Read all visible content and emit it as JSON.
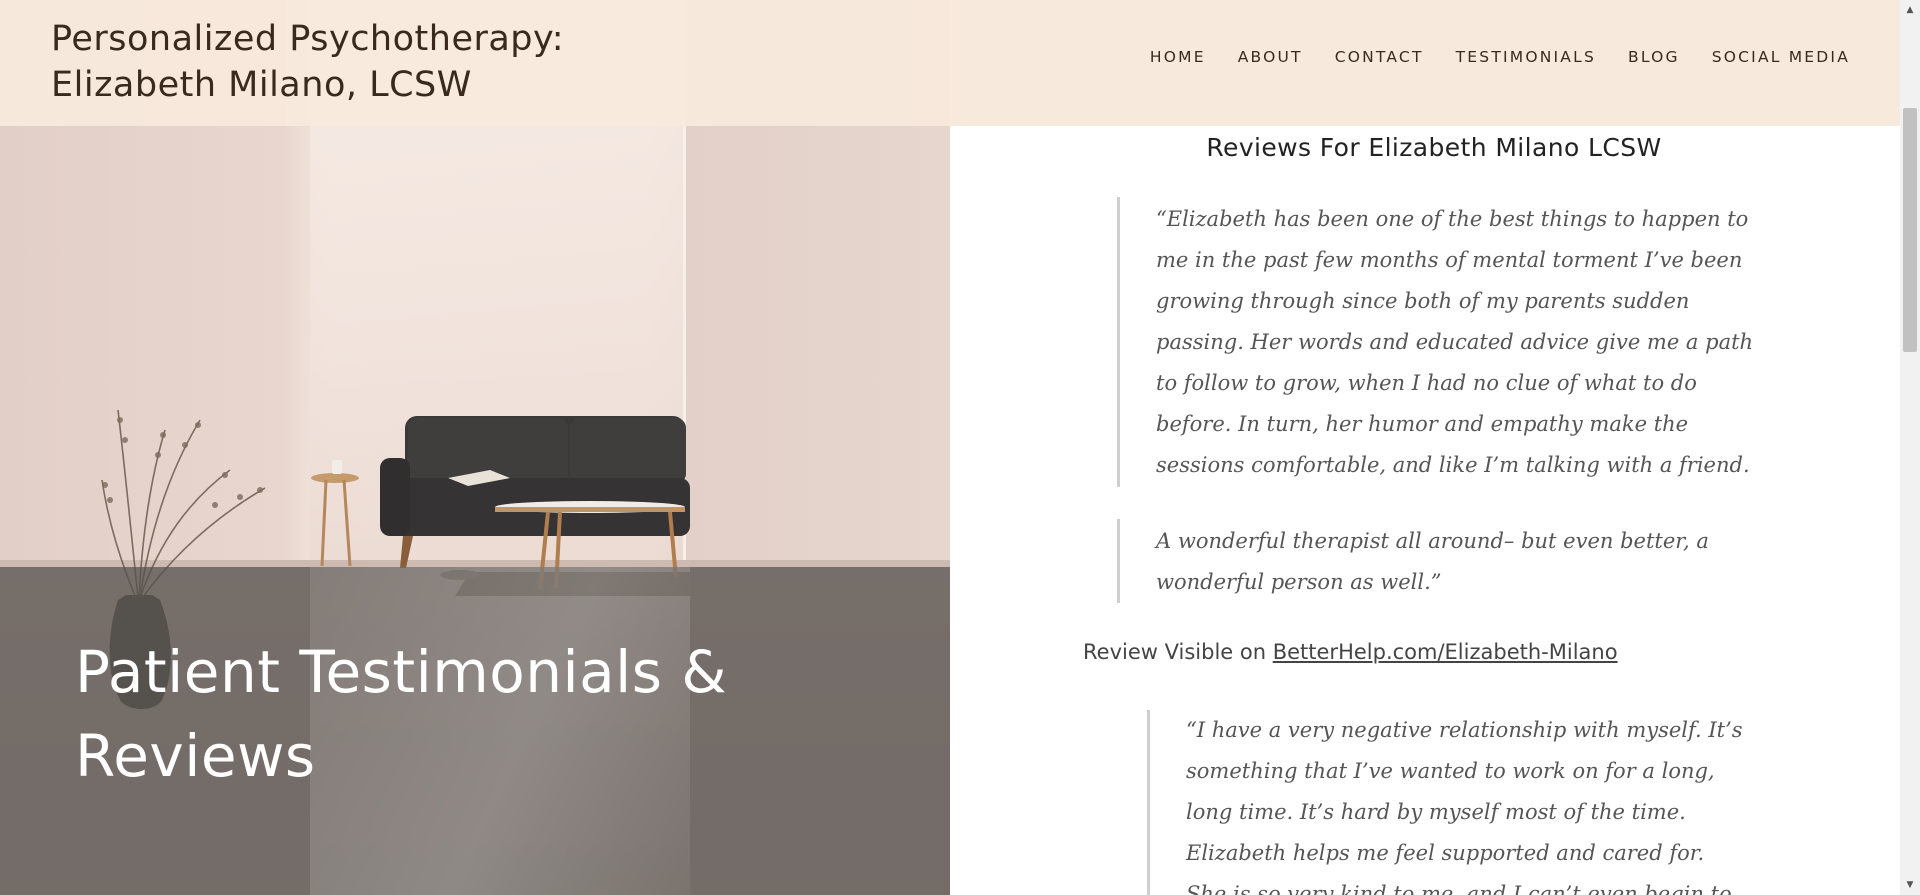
{
  "header": {
    "site_title_line1": "Personalized Psychotherapy:",
    "site_title_line2": "Elizabeth Milano, LCSW",
    "nav": [
      {
        "label": "HOME"
      },
      {
        "label": "ABOUT"
      },
      {
        "label": "CONTACT"
      },
      {
        "label": "TESTIMONIALS"
      },
      {
        "label": "BLOG"
      },
      {
        "label": "SOCIAL MEDIA"
      }
    ]
  },
  "hero": {
    "title_line1": "Patient Testimonials &",
    "title_line2": "Reviews"
  },
  "main": {
    "heading": "Reviews For Elizabeth Milano LCSW",
    "quotes": [
      {
        "lines": [
          "“Elizabeth has been one of the best things to happen to",
          "me in the past few months of mental torment I’ve been",
          "growing through since both of my parents sudden",
          "passing. Her words and educated advice give me a path",
          "to follow to grow, when I had no clue of what to do",
          "before. In turn, her humor and empathy make the",
          "sessions comfortable, and like I’m talking with a friend."
        ]
      },
      {
        "lines": [
          "A wonderful therapist all around– but even better, a",
          "wonderful person as well.”"
        ]
      },
      {
        "lines": [
          "“I have a very negative relationship with myself. It’s",
          "something that I’ve wanted to work on for a long,",
          "long time. It’s hard by myself most of the time.",
          "Elizabeth helps me feel supported and cared for.",
          "She is so very kind to me, and I can’t even begin to"
        ]
      }
    ],
    "review_visible_prefix": "Review Visible on ",
    "review_link_text": "BetterHelp.com/Elizabeth-Milano"
  },
  "colors": {
    "header_bg": "#f7eadc",
    "hero_overlay": "#55504e",
    "quote_border": "#cfcfcf",
    "quote_text": "#555555"
  },
  "icons": {
    "scroll_up": "triangle-up",
    "scroll_down": "triangle-down"
  }
}
